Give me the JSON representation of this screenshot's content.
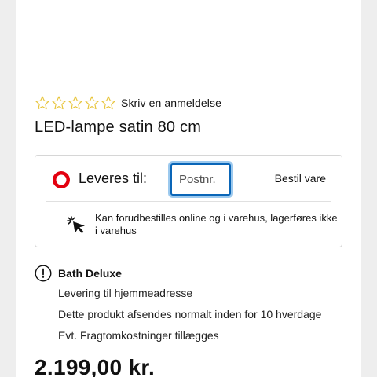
{
  "product": {
    "rating_value": 0,
    "rating_max": 5,
    "review_link": "Skriv en anmeldelse",
    "title": "LED-lampe satin 80 cm"
  },
  "delivery": {
    "label": "Leveres til:",
    "postal_placeholder": "Postnr.",
    "postal_value": "",
    "order_link": "Bestil vare",
    "availability": "Kan forudbestilles online og i varehus, lagerføres ikke i varehus"
  },
  "store_info": {
    "name": "Bath Deluxe",
    "details": [
      "Levering til hjemmeadresse",
      "Dette produkt afsendes normalt inden for 10 hverdage",
      "Evt. Fragtomkostninger tillægges"
    ]
  },
  "price": "2.199,00 kr.",
  "colors": {
    "star_outline": "#e8c53c",
    "target_red": "#e3000f",
    "focus_border": "#0a66b8",
    "focus_ring": "#9cc9ee"
  },
  "icons": {
    "rating": "star-icon",
    "delivery": "target-icon",
    "availability": "click-icon",
    "info": "exclamation-icon"
  }
}
